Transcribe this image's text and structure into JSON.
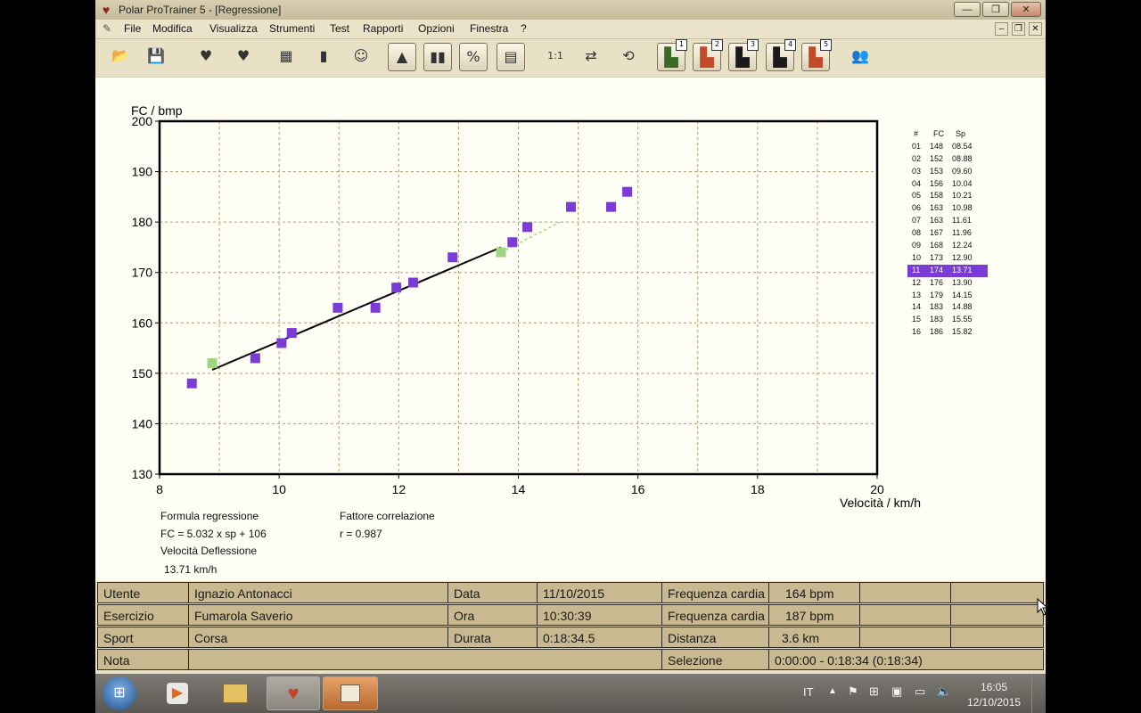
{
  "window": {
    "title": "Polar ProTrainer 5 - [Regressione]",
    "controls": {
      "minimize": "—",
      "restore": "❐",
      "close": "✕"
    }
  },
  "menu": {
    "items": [
      "File",
      "Modifica",
      "Visualizza",
      "Strumenti",
      "Test",
      "Rapporti",
      "Opzioni",
      "Finestra",
      "?"
    ],
    "mdi": {
      "minimize": "–",
      "restore": "❐",
      "close": "✕"
    }
  },
  "toolbar": {
    "buttons": [
      {
        "icon": "open-folder-icon",
        "glyph": "📂"
      },
      {
        "icon": "save-icon",
        "glyph": "💾"
      },
      {
        "icon": "sync-heart-icon",
        "glyph": "♥"
      },
      {
        "icon": "settings-heart-icon",
        "glyph": "♥"
      },
      {
        "icon": "calendar-icon",
        "glyph": "▦"
      },
      {
        "icon": "diary-book-icon",
        "glyph": "▮"
      },
      {
        "icon": "person-icon",
        "glyph": "☺"
      },
      {
        "icon": "area-chart-icon",
        "glyph": "▲"
      },
      {
        "icon": "bar-chart-icon",
        "glyph": "▮▮"
      },
      {
        "icon": "percent-chart-icon",
        "glyph": "%"
      },
      {
        "icon": "table-icon",
        "glyph": "▤"
      },
      {
        "icon": "zoom-icon",
        "glyph": "1:1"
      },
      {
        "icon": "compare-icon",
        "glyph": "⇄"
      },
      {
        "icon": "rotate-icon",
        "glyph": "⟲"
      },
      {
        "icon": "chart-1-icon",
        "glyph": "▙",
        "num": "1"
      },
      {
        "icon": "chart-2-icon",
        "glyph": "▙",
        "num": "2"
      },
      {
        "icon": "chart-3-icon",
        "glyph": "▙",
        "num": "3"
      },
      {
        "icon": "chart-4-icon",
        "glyph": "▙",
        "num": "4"
      },
      {
        "icon": "chart-5-icon",
        "glyph": "▙",
        "num": "5"
      },
      {
        "icon": "users-icon",
        "glyph": "👥"
      }
    ]
  },
  "chart_data": {
    "type": "scatter",
    "ylabel": "FC / bmp",
    "xlabel": "Velocità / km/h",
    "xlim": [
      8,
      20
    ],
    "ylim": [
      130,
      200
    ],
    "xticks": [
      8,
      10,
      12,
      14,
      16,
      18,
      20
    ],
    "yticks": [
      130,
      140,
      150,
      160,
      170,
      180,
      190,
      200
    ],
    "grid": true,
    "points": [
      {
        "x": 8.54,
        "y": 148
      },
      {
        "x": 8.88,
        "y": 152
      },
      {
        "x": 9.6,
        "y": 153
      },
      {
        "x": 10.04,
        "y": 156
      },
      {
        "x": 10.21,
        "y": 158
      },
      {
        "x": 10.98,
        "y": 163
      },
      {
        "x": 11.61,
        "y": 163
      },
      {
        "x": 11.96,
        "y": 167
      },
      {
        "x": 12.24,
        "y": 168
      },
      {
        "x": 12.9,
        "y": 173
      },
      {
        "x": 13.71,
        "y": 174
      },
      {
        "x": 13.9,
        "y": 176
      },
      {
        "x": 14.15,
        "y": 179
      },
      {
        "x": 14.88,
        "y": 183
      },
      {
        "x": 15.55,
        "y": 183
      },
      {
        "x": 15.82,
        "y": 186
      }
    ],
    "highlighted_indices": [
      1,
      10
    ],
    "regression_line": {
      "x_start": 8.88,
      "x_end": 13.71,
      "slope": 5.032,
      "intercept": 106
    },
    "dashed_extension": {
      "x_start": 13.71,
      "y_start": 174,
      "x_end": 14.7,
      "y_end": 180
    },
    "colors": {
      "points": "#7a3bd6",
      "highlight": "#9ed67f",
      "line": "#000000",
      "dashed": "#9ed67f",
      "grid": "#b89a6a"
    }
  },
  "regression": {
    "formula_title": "Formula regressione",
    "formula": "FC = 5.032 x sp + 106",
    "correlation_title": "Fattore correlazione",
    "correlation": "r = 0.987",
    "deflection_title": "Velocità Deflessione",
    "deflection": "13.71 km/h"
  },
  "lap_table": {
    "headers": [
      "#",
      "FC",
      "Sp"
    ],
    "rows": [
      [
        "01",
        "148",
        "08.54"
      ],
      [
        "02",
        "152",
        "08.88"
      ],
      [
        "03",
        "153",
        "09.60"
      ],
      [
        "04",
        "156",
        "10.04"
      ],
      [
        "05",
        "158",
        "10.21"
      ],
      [
        "06",
        "163",
        "10.98"
      ],
      [
        "07",
        "163",
        "11.61"
      ],
      [
        "08",
        "167",
        "11.96"
      ],
      [
        "09",
        "168",
        "12.24"
      ],
      [
        "10",
        "173",
        "12.90"
      ],
      [
        "11",
        "174",
        "13.71"
      ],
      [
        "12",
        "176",
        "13.90"
      ],
      [
        "13",
        "179",
        "14.15"
      ],
      [
        "14",
        "183",
        "14.88"
      ],
      [
        "15",
        "183",
        "15.55"
      ],
      [
        "16",
        "186",
        "15.82"
      ]
    ],
    "selected_index": 10
  },
  "info": {
    "utente_label": "Utente",
    "utente": "Ignazio Antonacci",
    "esercizio_label": "Esercizio",
    "esercizio": "Fumarola Saverio",
    "sport_label": "Sport",
    "sport": "Corsa",
    "nota_label": "Nota",
    "nota": "",
    "data_label": "Data",
    "data": "11/10/2015",
    "ora_label": "Ora",
    "ora": "10:30:39",
    "durata_label": "Durata",
    "durata": "0:18:34.5",
    "fc1_label": "Frequenza cardia",
    "fc1": "164 bpm",
    "fc2_label": "Frequenza cardia",
    "fc2": "187 bpm",
    "distanza_label": "Distanza",
    "distanza": "3.6 km",
    "selezione_label": "Selezione",
    "selezione": "0:00:00 - 0:18:34 (0:18:34)"
  },
  "taskbar": {
    "language": "IT",
    "time": "16:05",
    "date": "12/10/2015"
  }
}
